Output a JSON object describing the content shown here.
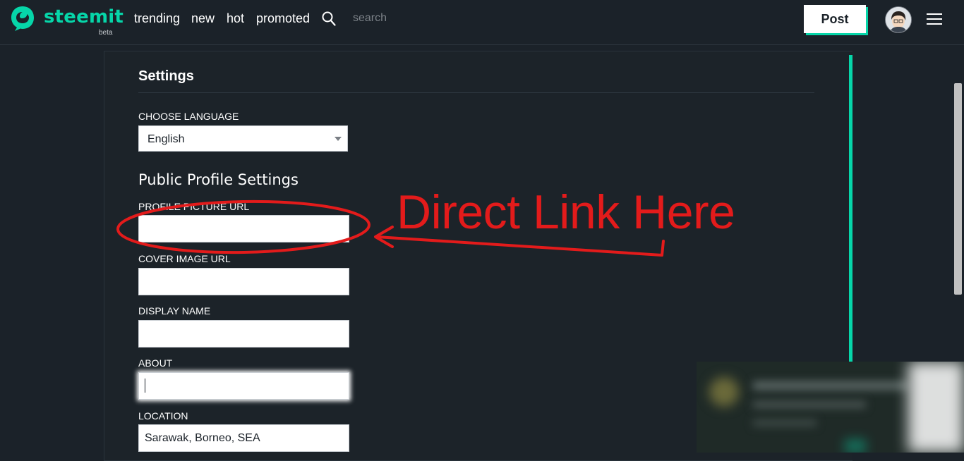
{
  "header": {
    "brand": "steemit",
    "beta_label": "beta",
    "nav": [
      "trending",
      "new",
      "hot",
      "promoted"
    ],
    "search_placeholder": "search",
    "post_button": "Post",
    "accent_color": "#06d6a9"
  },
  "settings": {
    "title": "Settings",
    "language_label": "CHOOSE LANGUAGE",
    "language_value": "English",
    "section_title": "Public Profile Settings",
    "fields": [
      {
        "label": "PROFILE PICTURE URL",
        "value": ""
      },
      {
        "label": "COVER IMAGE URL",
        "value": ""
      },
      {
        "label": "DISPLAY NAME",
        "value": ""
      },
      {
        "label": "ABOUT",
        "value": ""
      },
      {
        "label": "LOCATION",
        "value": "Sarawak, Borneo, SEA"
      }
    ]
  },
  "annotation": {
    "text": "Direct Link Here",
    "color": "#e31b1b"
  }
}
